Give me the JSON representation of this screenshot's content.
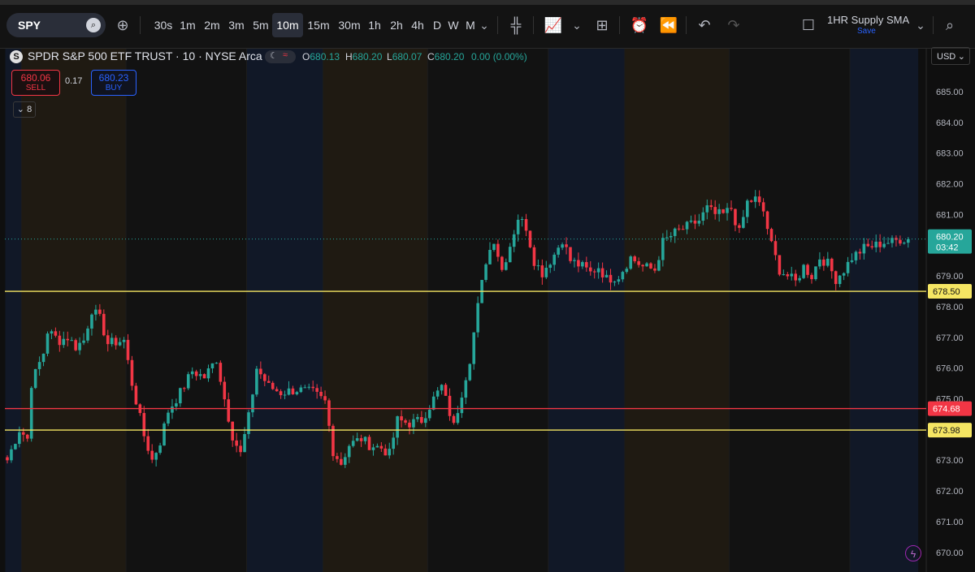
{
  "toolbar": {
    "symbol": "SPY",
    "timeframes": [
      "30s",
      "1m",
      "2m",
      "3m",
      "5m",
      "10m",
      "15m",
      "30m",
      "1h",
      "2h",
      "4h",
      "D",
      "W",
      "M"
    ],
    "active_timeframe": "10m",
    "layout_name": "1HR Supply SMA",
    "save_label": "Save",
    "icons": [
      "search-icon",
      "add-compare-icon",
      "candle-type-icon",
      "indicators-icon",
      "chevron-down-icon",
      "layouts-icon",
      "alert-icon",
      "replay-icon",
      "undo-icon",
      "redo-icon",
      "square-icon",
      "chevron-down-icon",
      "search-zoom-icon"
    ]
  },
  "legend": {
    "logo": "S",
    "title": "SPDR S&P 500 ETF TRUST · 10 · NYSE Arca",
    "o_label": "O",
    "o": "680.13",
    "h_label": "H",
    "h": "680.20",
    "l_label": "L",
    "l": "680.07",
    "c_label": "C",
    "c": "680.20",
    "change": "0.00 (0.00%)"
  },
  "trade": {
    "sell_price": "680.06",
    "sell_label": "SELL",
    "spread": "0.17",
    "buy_price": "680.23",
    "buy_label": "BUY"
  },
  "indicators_collapsed": "8",
  "currency": "USD",
  "colors": {
    "up": "#26a69a",
    "down": "#f23645",
    "support": "#f5e663",
    "resistance": "#f23645",
    "bg": "#0f0f0f",
    "session_orange": "#1f1a12",
    "session_blue": "#111827"
  },
  "chart_data": {
    "type": "candlestick",
    "title": "SPDR S&P 500 ETF TRUST · 10 · NYSE Arca",
    "interval": "10m",
    "ylim": [
      669.8,
      685.8
    ],
    "y_ticks": [
      "685.00",
      "684.00",
      "683.00",
      "682.00",
      "681.00",
      "680.00",
      "679.00",
      "678.00",
      "677.00",
      "676.00",
      "675.00",
      "674.00",
      "673.00",
      "672.00",
      "671.00",
      "670.00"
    ],
    "last_price": "680.20",
    "countdown": "03:42",
    "horizontal_lines": [
      {
        "price": 678.5,
        "label": "678.50",
        "color": "#f5e663"
      },
      {
        "price": 674.68,
        "label": "674.68",
        "color": "#f23645"
      },
      {
        "price": 673.98,
        "label": "673.98",
        "color": "#f5e663"
      }
    ],
    "sessions": [
      {
        "start": 0,
        "end": 4,
        "kind": "blue"
      },
      {
        "start": 4,
        "end": 30,
        "kind": "orange"
      },
      {
        "start": 30,
        "end": 60,
        "kind": "dark"
      },
      {
        "start": 60,
        "end": 79,
        "kind": "blue"
      },
      {
        "start": 79,
        "end": 105,
        "kind": "orange"
      },
      {
        "start": 105,
        "end": 135,
        "kind": "dark"
      },
      {
        "start": 135,
        "end": 154,
        "kind": "blue"
      },
      {
        "start": 154,
        "end": 180,
        "kind": "orange"
      },
      {
        "start": 180,
        "end": 210,
        "kind": "dark"
      },
      {
        "start": 210,
        "end": 227,
        "kind": "blue"
      }
    ],
    "waypoints": [
      [
        0,
        673.0
      ],
      [
        3,
        674.0
      ],
      [
        5,
        673.7
      ],
      [
        6,
        675.5
      ],
      [
        9,
        676.5
      ],
      [
        10,
        677.2
      ],
      [
        13,
        676.9
      ],
      [
        15,
        677.0
      ],
      [
        17,
        676.7
      ],
      [
        19,
        676.9
      ],
      [
        21,
        677.9
      ],
      [
        23,
        677.6
      ],
      [
        25,
        676.8
      ],
      [
        29,
        676.9
      ],
      [
        31,
        675.5
      ],
      [
        34,
        673.8
      ],
      [
        36,
        673.0
      ],
      [
        38,
        673.6
      ],
      [
        40,
        674.6
      ],
      [
        43,
        675.2
      ],
      [
        46,
        675.9
      ],
      [
        49,
        675.7
      ],
      [
        52,
        676.3
      ],
      [
        54,
        675.0
      ],
      [
        56,
        673.8
      ],
      [
        58,
        673.2
      ],
      [
        60,
        674.4
      ],
      [
        62,
        676.0
      ],
      [
        65,
        675.4
      ],
      [
        68,
        675.2
      ],
      [
        72,
        675.3
      ],
      [
        76,
        675.2
      ],
      [
        79,
        674.9
      ],
      [
        81,
        673.3
      ],
      [
        83,
        672.9
      ],
      [
        85,
        673.5
      ],
      [
        88,
        673.7
      ],
      [
        90,
        673.5
      ],
      [
        93,
        673.4
      ],
      [
        95,
        673.2
      ],
      [
        97,
        674.3
      ],
      [
        100,
        674.2
      ],
      [
        103,
        674.3
      ],
      [
        106,
        675.0
      ],
      [
        108,
        675.4
      ],
      [
        111,
        674.1
      ],
      [
        113,
        675.2
      ],
      [
        115,
        676.3
      ],
      [
        117,
        678.0
      ],
      [
        119,
        679.5
      ],
      [
        121,
        680.2
      ],
      [
        123,
        679.2
      ],
      [
        125,
        680.0
      ],
      [
        127,
        680.9
      ],
      [
        129,
        680.6
      ],
      [
        131,
        679.5
      ],
      [
        133,
        679.1
      ],
      [
        136,
        679.7
      ],
      [
        138,
        680.2
      ],
      [
        140,
        679.5
      ],
      [
        143,
        679.3
      ],
      [
        145,
        679.1
      ],
      [
        147,
        679.3
      ],
      [
        149,
        678.9
      ],
      [
        152,
        679.0
      ],
      [
        155,
        679.6
      ],
      [
        158,
        679.3
      ],
      [
        161,
        679.2
      ],
      [
        163,
        680.1
      ],
      [
        166,
        680.4
      ],
      [
        169,
        680.6
      ],
      [
        172,
        680.8
      ],
      [
        174,
        681.2
      ],
      [
        176,
        681.0
      ],
      [
        178,
        681.0
      ],
      [
        180,
        681.2
      ],
      [
        182,
        680.4
      ],
      [
        184,
        681.4
      ],
      [
        186,
        681.5
      ],
      [
        188,
        681.1
      ],
      [
        190,
        680.0
      ],
      [
        192,
        679.2
      ],
      [
        194,
        679.0
      ],
      [
        196,
        678.8
      ],
      [
        198,
        679.3
      ],
      [
        200,
        679.0
      ],
      [
        202,
        679.6
      ],
      [
        204,
        679.4
      ],
      [
        206,
        678.9
      ],
      [
        208,
        679.2
      ],
      [
        210,
        679.6
      ],
      [
        213,
        679.9
      ],
      [
        216,
        680.0
      ],
      [
        218,
        680.1
      ],
      [
        220,
        680.1
      ],
      [
        222,
        680.2
      ],
      [
        224,
        680.2
      ]
    ]
  }
}
